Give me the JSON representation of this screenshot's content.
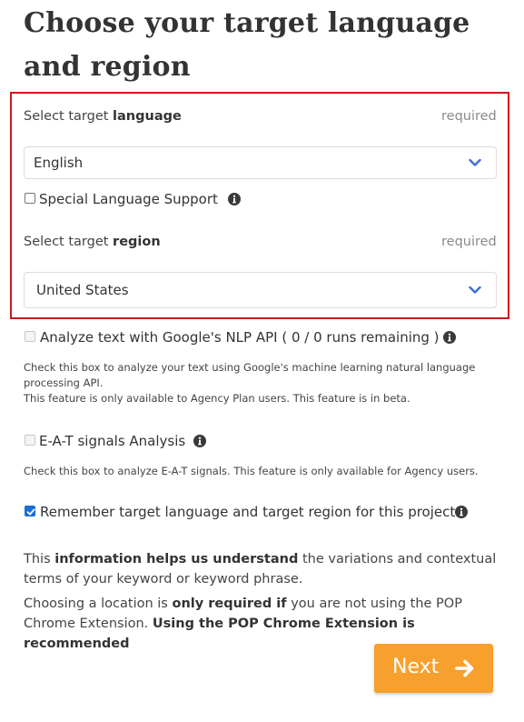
{
  "page": {
    "title": "Choose your target language and region"
  },
  "language": {
    "label_prefix": "Select target ",
    "label_bold": "language",
    "required": "required",
    "value": "English"
  },
  "special_support": {
    "label": "Special Language Support",
    "checked": false
  },
  "region": {
    "label_prefix": "Select target ",
    "label_bold": "region",
    "required": "required",
    "value": "United States"
  },
  "nlp": {
    "label": "Analyze text with Google's NLP API ( 0 / 0 runs remaining )",
    "help_line1": "Check this box to analyze your text using Google's machine learning natural language",
    "help_line2": "processing API.",
    "help_line3": "This feature is only available to Agency Plan users. This feature is in beta.",
    "checked": false,
    "disabled": true
  },
  "eat": {
    "label": "E-A-T signals Analysis",
    "help": "Check this box to analyze E-A-T signals. This feature is only available for Agency users.",
    "checked": false,
    "disabled": true
  },
  "remember": {
    "label": "Remember target language and target region for this project",
    "checked": true
  },
  "info": {
    "p1_a": "This ",
    "p1_b": "information helps us understand",
    "p1_c": " the variations and contextual terms of your keyword or keyword phrase.",
    "p2_a": "Choosing a location is ",
    "p2_b": "only required if",
    "p2_c": " you are not using the POP Chrome Extension. ",
    "p2_d": "Using the POP Chrome Extension is recommended"
  },
  "next_button": {
    "label": "Next"
  },
  "colors": {
    "highlight_border": "#d0161d",
    "accent_button": "#f8a02d",
    "chevron": "#3d6fd1",
    "checkbox_checked": "#1a6fd9"
  },
  "icons": [
    "chevron-down-icon",
    "info-icon",
    "arrow-right-icon",
    "checkmark-icon"
  ]
}
